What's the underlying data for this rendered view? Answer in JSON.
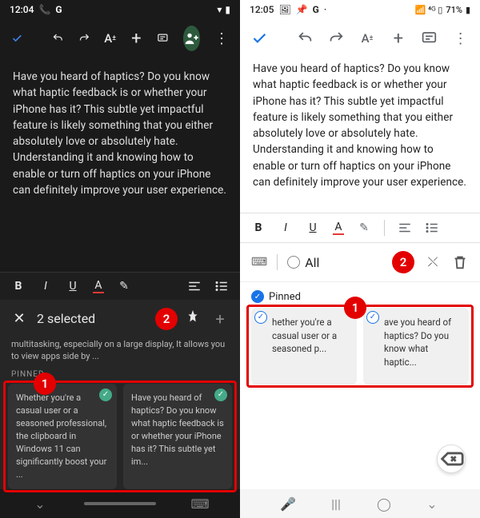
{
  "left": {
    "status": {
      "time": "12:04",
      "icons": [
        "📞",
        "G"
      ],
      "right": [
        "📶",
        "🔋"
      ]
    },
    "doc_text": "Have you heard of haptics? Do you know what haptic feedback is or whether your iPhone has it? This subtle yet impactful feature is likely something that you either absolutely love or absolutely hate. Understanding it and knowing how to enable or turn off haptics on your iPhone can definitely improve your user experience.",
    "selected_label": "2 selected",
    "preview_text": "multitasking, especially on a large display, It allows you to view apps side by ...",
    "pinned_label": "PINNED",
    "cards": [
      "Whether you're a casual user or a seasoned professional, the clipboard in Windows 11 can significantly boost your ...",
      "Have you heard of haptics? Do you know what haptic feedback is or whether your iPhone has it? This subtle yet im..."
    ],
    "callouts": {
      "pin_count": "2",
      "card_marker": "1"
    }
  },
  "right": {
    "status": {
      "time": "12:05",
      "icons": [
        "🖼",
        "📌",
        "G",
        "·"
      ],
      "right": "71%"
    },
    "doc_text": "Have you heard of haptics? Do you know what haptic feedback is or whether your iPhone has it? This subtle yet impactful feature is likely something that you either absolutely love or absolutely hate. Understanding it and knowing how to enable or turn off haptics on your iPhone can definitely improve your user experience.",
    "all_label": "All",
    "pinned_label": "Pinned",
    "cards": [
      "hether you're a casual user or a seasoned p...",
      "ave you heard of haptics? Do you know what haptic..."
    ],
    "callouts": {
      "delete_marker": "2",
      "card_marker": "1"
    }
  },
  "fmt_letters": {
    "b": "B",
    "i": "I",
    "u": "U",
    "a": "A"
  }
}
